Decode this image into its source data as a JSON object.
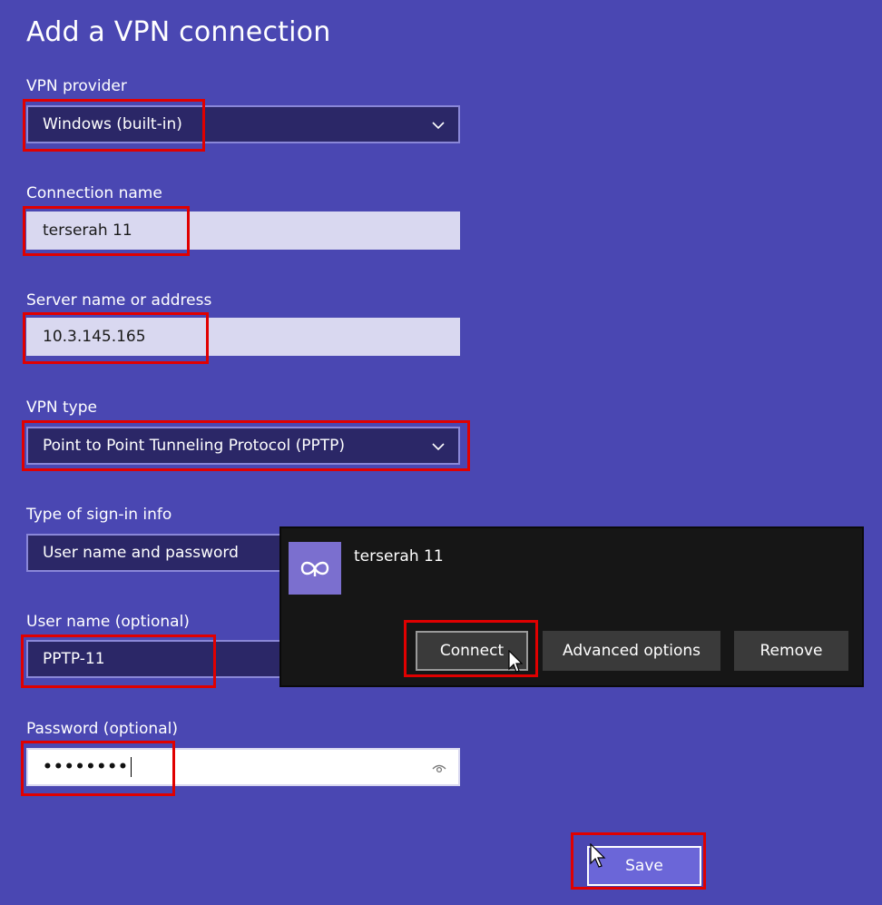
{
  "page_title": "Add a VPN connection",
  "vpn_provider": {
    "label": "VPN provider",
    "value": "Windows (built-in)"
  },
  "connection_name": {
    "label": "Connection name",
    "value": "terserah 11"
  },
  "server": {
    "label": "Server name or address",
    "value": "10.3.145.165"
  },
  "vpn_type": {
    "label": "VPN type",
    "value": "Point to Point Tunneling Protocol (PPTP)"
  },
  "signin_type": {
    "label": "Type of sign-in info",
    "value": "User name and password"
  },
  "username": {
    "label": "User name (optional)",
    "value": "PPTP-11"
  },
  "password": {
    "label": "Password (optional)",
    "value": "••••••••"
  },
  "save_label": "Save",
  "popup": {
    "connection_name": "terserah 11",
    "connect_label": "Connect",
    "advanced_label": "Advanced options",
    "remove_label": "Remove"
  },
  "colors": {
    "background": "#4a47b2",
    "highlight": "#e00000",
    "popup_bg": "#161616"
  },
  "icons": [
    "chevron-down-icon",
    "eye-icon",
    "vpn-icon",
    "mouse-cursor-icon"
  ]
}
